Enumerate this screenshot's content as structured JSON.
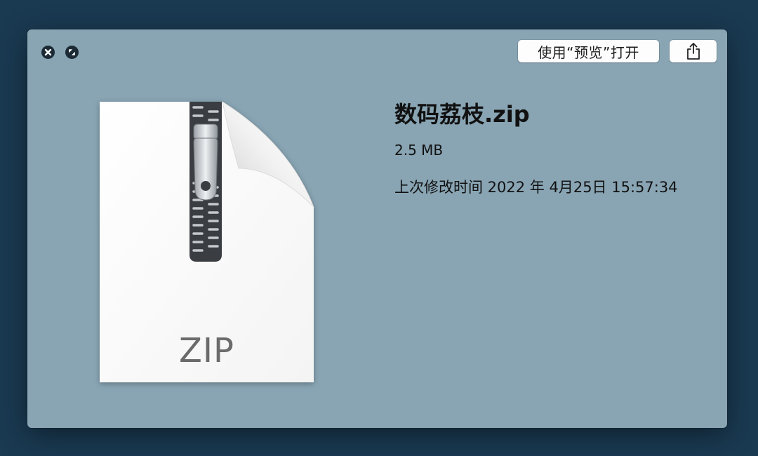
{
  "window": {
    "controls": {
      "close_icon": "close-icon",
      "fullscreen_icon": "fullscreen-icon"
    },
    "toolbar": {
      "open_with_label": "使用“预览”打开",
      "share_icon": "share-icon"
    }
  },
  "file": {
    "icon": "zip-file-icon",
    "type_label": "ZIP",
    "name": "数码荔枝.zip",
    "size": "2.5 MB",
    "modified": "上次修改时间 2022 年 4月25日 15:57:34"
  },
  "colors": {
    "desktop_background": "#1a3a52",
    "window_background": "#89a5b4",
    "control_dark": "#1b2a35",
    "button_background": "#fdfdfd"
  }
}
